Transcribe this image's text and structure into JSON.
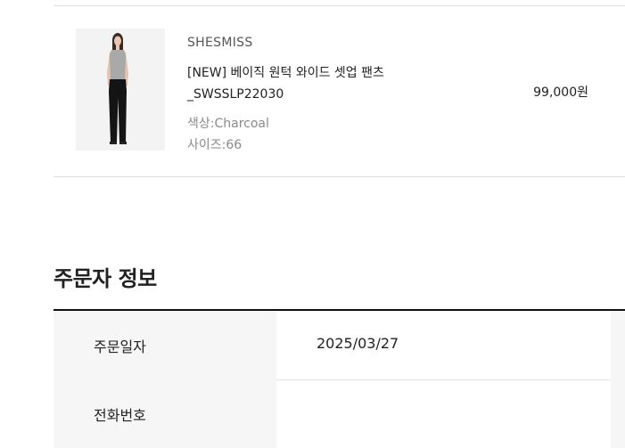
{
  "product": {
    "brand": "SHESMISS",
    "name_line1": "[NEW] 베이직 원턱 와이드 셋업 팬츠",
    "name_line2": "_SWSSLP22030",
    "color_option": "색상:Charcoal",
    "size_option": "사이즈:66",
    "price": "99,000원"
  },
  "orderer_section": {
    "title": "주문자 정보",
    "rows": [
      {
        "label": "주문일자",
        "value": "2025/03/27"
      },
      {
        "label": "전화번호",
        "value": ""
      }
    ]
  }
}
